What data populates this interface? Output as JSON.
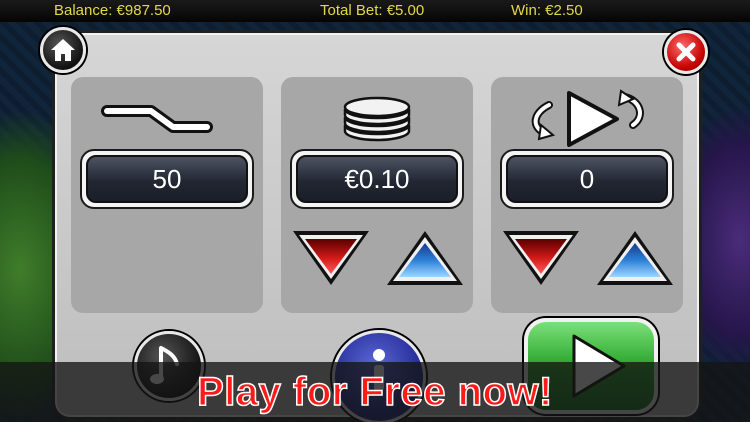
{
  "status_bar": {
    "balance": "Balance: €987.50",
    "total_bet": "Total Bet: €5.00",
    "win": "Win: €2.50"
  },
  "settings": {
    "lines": {
      "icon": "paylines-icon",
      "value": "50"
    },
    "coin_value": {
      "icon": "coin-stack-icon",
      "value": "€0.10"
    },
    "autoplay": {
      "icon": "autoplay-icon",
      "value": "0"
    }
  },
  "buttons": {
    "home": "home-icon",
    "close": "close-icon",
    "music": "music-note-icon",
    "info": "info-icon",
    "play": "play-icon"
  },
  "promo": {
    "text": "Play for Free now!"
  },
  "colors": {
    "status_text": "#e3d84a",
    "decrease": "#c81414",
    "increase": "#2a7fd6",
    "play": "#2aa52b",
    "close": "#c40000",
    "promo_text": "#ff1a1a"
  }
}
